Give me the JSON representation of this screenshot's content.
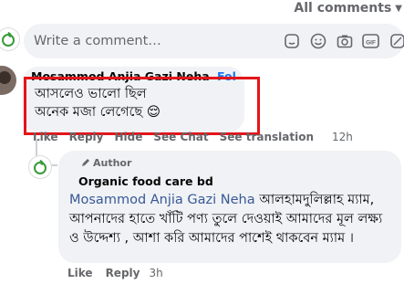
{
  "header": {
    "all_comments_label": "All comments"
  },
  "composer": {
    "placeholder": "Write a comment…",
    "icons": [
      "sticker-icon",
      "emoji-icon",
      "camera-icon",
      "gif-icon",
      "avatar-sticker-icon"
    ],
    "gif_label": "GIF"
  },
  "comment": {
    "author": "Mosammod Anjia Gazi Neha",
    "follow_label": "Follow",
    "lines": [
      "আসলেও ভালো ছিল",
      "অনেক মজা লেগেছে 😌"
    ],
    "actions": {
      "like": "Like",
      "reply": "Reply",
      "hide": "Hide",
      "see_chat": "See Chat",
      "see_translation": "See translation"
    },
    "time": "12h",
    "highlight_color": "#e3151a"
  },
  "reply": {
    "badge": "Author",
    "author": "Organic food care bd",
    "mention": "Mosammod Anjia Gazi Neha",
    "text": "আলহামদুলিল্লাহ ম্যাম, আপনাদের হাতে খাঁটি পণ্য তুলে দেওয়াই আমাদের মূল লক্ষ্য ও উদ্দেশ্য , আশা করি আমাদের পাশেই থাকবেন ম্যাম ।",
    "actions": {
      "like": "Like",
      "reply": "Reply"
    },
    "time": "3h"
  },
  "colors": {
    "bubble_bg": "#f0f2f5",
    "meta_text": "#65676b",
    "link": "#385898",
    "brand_green": "#3a9a3a"
  }
}
